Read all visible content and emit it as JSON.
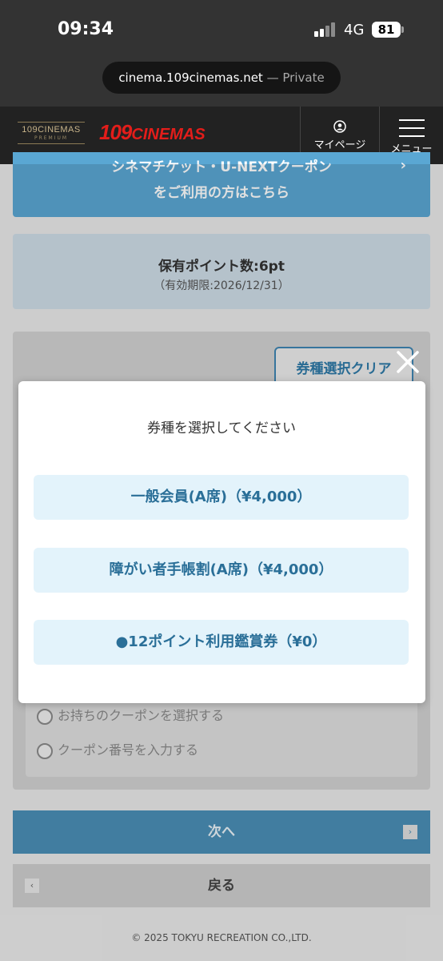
{
  "status": {
    "time": "09:34",
    "network": "4G",
    "battery": "81"
  },
  "browser": {
    "domain": "cinema.109cinemas.net",
    "mode": "— Private"
  },
  "header": {
    "premium_logo_line1": "109CINEMAS",
    "premium_logo_line2": "PREMIUM",
    "logo_number": "109",
    "logo_name": "CINEMAS",
    "mypage_label": "マイページ",
    "menu_label": "メニュー"
  },
  "coupon_banner": {
    "line1": "シネマチケット・U-NEXTクーポン",
    "line2": "をご利用の方はこちら",
    "chevron": "›"
  },
  "points": {
    "title": "保有ポイント数:6pt",
    "expiry": "（有効期限:2026/12/31）"
  },
  "clear_button": "券種選択クリア",
  "coupon_options": [
    "お持ちのクーポンを選択する",
    "クーポン番号を入力する"
  ],
  "nav": {
    "next_label": "次へ",
    "back_label": "戻る",
    "next_arrow": "›",
    "back_arrow": "‹"
  },
  "copyright": "© 2025 TOKYU RECREATION CO.,LTD.",
  "modal": {
    "title": "券種を選択してください",
    "options": [
      "一般会員(A席)（¥4,000）",
      "障がい者手帳割(A席)（¥4,000）",
      "●12ポイント利用鑑賞券（¥0）"
    ]
  },
  "colors": {
    "accent": "#4a8fb7",
    "option_bg": "#e3f3fb",
    "brand_red": "#e31d1a"
  }
}
